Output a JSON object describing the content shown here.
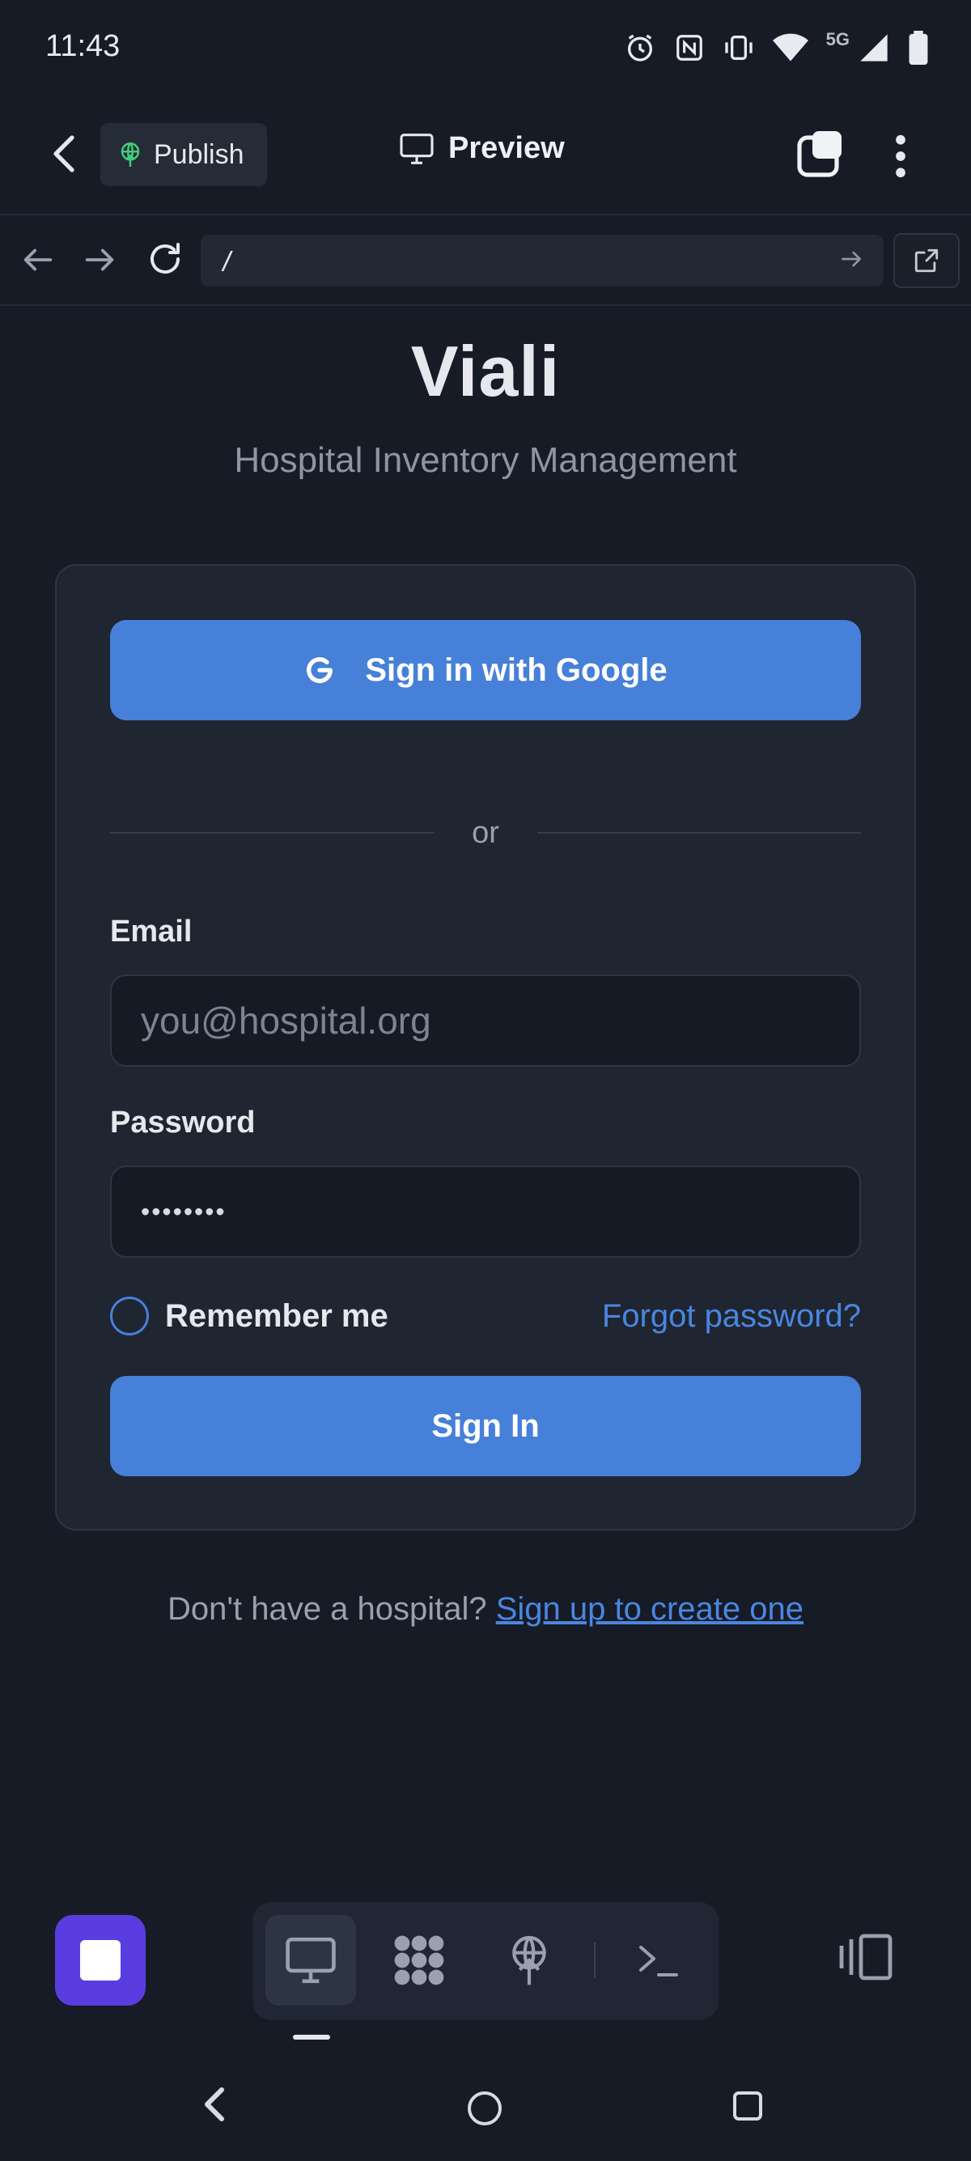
{
  "status_bar": {
    "time": "11:43",
    "network": "5G"
  },
  "app_bar": {
    "publish_label": "Publish",
    "title": "Preview"
  },
  "browser": {
    "url": "/"
  },
  "page": {
    "brand": "Viali",
    "tagline": "Hospital Inventory Management",
    "google_button_label": "Sign in with Google",
    "divider_text": "or",
    "email_label": "Email",
    "email_placeholder": "you@hospital.org",
    "password_label": "Password",
    "password_value": "••••••••",
    "remember_label": "Remember me",
    "forgot_link": "Forgot password?",
    "signin_button_label": "Sign In",
    "signup_prompt": "Don't have a hospital?",
    "signup_link": "Sign up to create one"
  },
  "dock": {
    "items": [
      "desktop-icon",
      "apps-icon",
      "publish-icon",
      "terminal-icon"
    ],
    "active": "desktop-icon"
  },
  "colors": {
    "background": "#161b26",
    "card": "#1f2531",
    "accent": "#4680d8",
    "link": "#4a86e0",
    "stop_button": "#5a3de0",
    "publish_icon": "#3ecf7a"
  }
}
